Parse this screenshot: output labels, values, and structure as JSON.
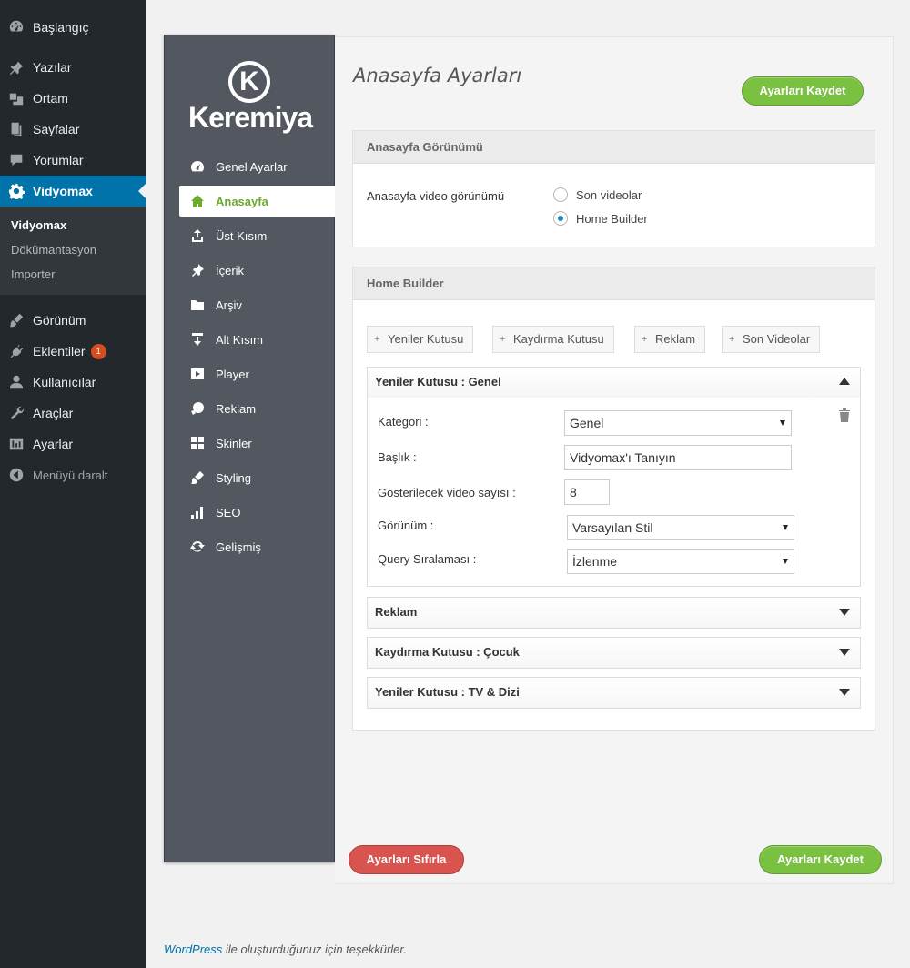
{
  "wp_menu": {
    "items": [
      {
        "label": "Başlangıç",
        "icon": "dashboard-icon"
      },
      {
        "label": "Yazılar",
        "icon": "pin-icon"
      },
      {
        "label": "Ortam",
        "icon": "media-icon"
      },
      {
        "label": "Sayfalar",
        "icon": "pages-icon"
      },
      {
        "label": "Yorumlar",
        "icon": "comments-icon"
      },
      {
        "label": "Vidyomax",
        "icon": "gear-icon"
      }
    ],
    "submenu": [
      "Vidyomax",
      "Dökümantasyon",
      "Importer"
    ],
    "items2": [
      {
        "label": "Görünüm",
        "icon": "brush-icon"
      },
      {
        "label": "Eklentiler",
        "icon": "plugin-icon",
        "badge": "1"
      },
      {
        "label": "Kullanıcılar",
        "icon": "user-icon"
      },
      {
        "label": "Araçlar",
        "icon": "wrench-icon"
      },
      {
        "label": "Ayarlar",
        "icon": "settings-icon"
      }
    ],
    "collapse": "Menüyü daralt"
  },
  "theme": {
    "logo_letter": "K",
    "logo_text": "Keremiya",
    "nav": [
      "Genel Ayarlar",
      "Anasayfa",
      "Üst Kısım",
      "İçerik",
      "Arşiv",
      "Alt Kısım",
      "Player",
      "Reklam",
      "Skinler",
      "Styling",
      "SEO",
      "Gelişmiş"
    ]
  },
  "page": {
    "title": "Anasayfa Ayarları",
    "save_top": "Ayarları Kaydet",
    "save_bottom": "Ayarları Kaydet",
    "reset": "Ayarları Sıfırla"
  },
  "view_box": {
    "title": "Anasayfa Görünümü",
    "label": "Anasayfa video görünümü",
    "options": [
      "Son videolar",
      "Home Builder"
    ],
    "selected": "Home Builder"
  },
  "builder": {
    "title": "Home Builder",
    "add_buttons": [
      "Yeniler Kutusu",
      "Kaydırma Kutusu",
      "Reklam",
      "Son Videolar"
    ],
    "open_panel": {
      "title": "Yeniler Kutusu : Genel",
      "fields": {
        "kategori_label": "Kategori :",
        "kategori_value": "Genel",
        "baslik_label": "Başlık :",
        "baslik_value": "Vidyomax'ı Tanıyın",
        "count_label": "Gösterilecek video sayısı :",
        "count_value": "8",
        "gorunum_label": "Görünüm :",
        "gorunum_value": "Varsayılan Stil",
        "query_label": "Query Sıralaması :",
        "query_value": "İzlenme"
      }
    },
    "closed_panels": [
      "Reklam",
      "Kaydırma Kutusu : Çocuk",
      "Yeniler Kutusu : TV & Dizi"
    ]
  },
  "footer": {
    "link": "WordPress",
    "text": " ile oluşturduğunuz için teşekkürler."
  }
}
